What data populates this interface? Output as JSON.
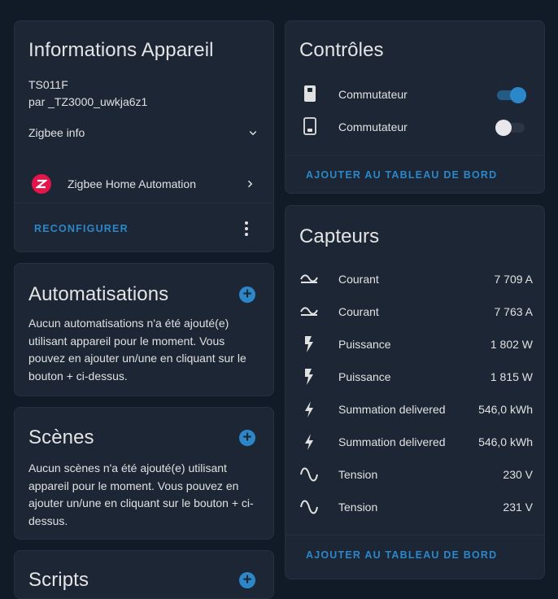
{
  "device_info": {
    "title": "Informations Appareil",
    "model": "TS011F",
    "manufacturer": "par _TZ3000_uwkja6z1",
    "zigbee_info_label": "Zigbee info",
    "integration_label": "Zigbee Home Automation",
    "reconfigure_label": "RECONFIGURER"
  },
  "automations": {
    "title": "Automatisations",
    "text": "Aucun automatisations n'a été ajouté(e) utilisant appareil pour le moment. Vous pouvez en ajouter un/une en cliquant sur le bouton + ci-dessus."
  },
  "scenes": {
    "title": "Scènes",
    "text": "Aucun scènes n'a été ajouté(e) utilisant appareil pour le moment. Vous pouvez en ajouter un/une en cliquant sur le bouton + ci-dessus."
  },
  "scripts": {
    "title": "Scripts"
  },
  "controls": {
    "title": "Contrôles",
    "items": [
      {
        "label": "Commutateur",
        "icon": "switch-on-icon",
        "state": true
      },
      {
        "label": "Commutateur",
        "icon": "switch-off-icon",
        "state": false
      }
    ],
    "add_label": "AJOUTER AU TABLEAU DE BORD"
  },
  "sensors": {
    "title": "Capteurs",
    "items": [
      {
        "label": "Courant",
        "value": "7 709 A",
        "icon": "current-ac-icon"
      },
      {
        "label": "Courant",
        "value": "7 763 A",
        "icon": "current-ac-icon"
      },
      {
        "label": "Puissance",
        "value": "1 802 W",
        "icon": "flash-icon"
      },
      {
        "label": "Puissance",
        "value": "1 815 W",
        "icon": "flash-icon"
      },
      {
        "label": "Summation delivered",
        "value": "546,0 kWh",
        "icon": "lightning-bolt-icon"
      },
      {
        "label": "Summation delivered",
        "value": "546,0 kWh",
        "icon": "lightning-bolt-icon"
      },
      {
        "label": "Tension",
        "value": "230 V",
        "icon": "sine-wave-icon"
      },
      {
        "label": "Tension",
        "value": "231 V",
        "icon": "sine-wave-icon"
      }
    ],
    "add_label": "AJOUTER AU TABLEAU DE BORD"
  },
  "colors": {
    "background": "#111b27",
    "card": "#1c2634",
    "accent": "#2c87c9",
    "zha_red": "#e5144b"
  }
}
